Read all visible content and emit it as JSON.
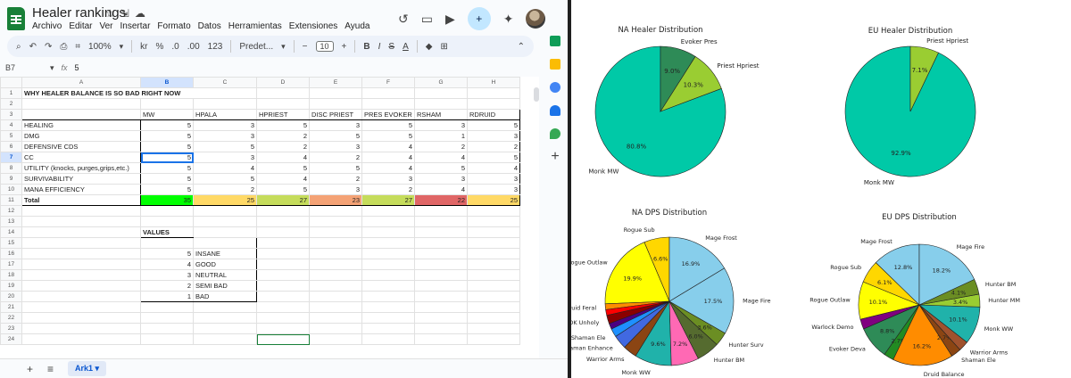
{
  "app": {
    "title": "Healer rankings",
    "menu": [
      "Archivo",
      "Editar",
      "Ver",
      "Insertar",
      "Formato",
      "Datos",
      "Herramientas",
      "Extensiones",
      "Ayuda"
    ]
  },
  "toolbar": {
    "zoom": "100%",
    "currency": "kr",
    "percent": "%",
    "dec_decrease": ".0",
    "dec_increase": ".00",
    "format_123": "123",
    "font": "Predet...",
    "font_size": "10",
    "minus": "−",
    "plus": "+",
    "bold": "B",
    "italic": "I",
    "strike": "S",
    "color_a": "A"
  },
  "formula_bar": {
    "name_box": "B7",
    "fx": "fx",
    "value": "5"
  },
  "grid": {
    "columns": [
      "A",
      "B",
      "C",
      "D",
      "E",
      "F",
      "G",
      "H"
    ],
    "title_row": "WHY HEALER BALANCE IS SO BAD RIGHT NOW",
    "headers": [
      "MW",
      "HPALA",
      "HPRIEST",
      "DISC PRIEST",
      "PRES EVOKER",
      "RSHAM",
      "RDRUID"
    ],
    "rows": [
      {
        "label": "HEALING",
        "values": [
          "5",
          "3",
          "5",
          "3",
          "5",
          "3",
          "5"
        ]
      },
      {
        "label": "DMG",
        "values": [
          "5",
          "3",
          "2",
          "5",
          "5",
          "1",
          "3"
        ]
      },
      {
        "label": "DEFENSIVE CDS",
        "values": [
          "5",
          "5",
          "2",
          "3",
          "4",
          "2",
          "2"
        ]
      },
      {
        "label": "CC",
        "values": [
          "5",
          "3",
          "4",
          "2",
          "4",
          "4",
          "5"
        ]
      },
      {
        "label": "UTILITY (knocks, purges,grips,etc.)",
        "values": [
          "5",
          "4",
          "5",
          "5",
          "4",
          "5",
          "4"
        ]
      },
      {
        "label": "SURVIVABILITY",
        "values": [
          "5",
          "5",
          "4",
          "2",
          "3",
          "3",
          "3"
        ]
      },
      {
        "label": "MANA EFFICIENCY",
        "values": [
          "5",
          "2",
          "5",
          "3",
          "2",
          "4",
          "3"
        ]
      }
    ],
    "total": {
      "label": "Total",
      "values": [
        "35",
        "25",
        "27",
        "23",
        "27",
        "22",
        "25"
      ],
      "colors": [
        "#00ff00",
        "#ffd966",
        "#c5dc5b",
        "#f4a275",
        "#c5dc5b",
        "#e06666",
        "#ffd966"
      ]
    },
    "values_title": "VALUES",
    "values_legend": [
      {
        "n": "5",
        "label": "INSANE"
      },
      {
        "n": "4",
        "label": "GOOD"
      },
      {
        "n": "3",
        "label": "NEUTRAL"
      },
      {
        "n": "2",
        "label": "SEMI BAD"
      },
      {
        "n": "1",
        "label": "BAD"
      }
    ]
  },
  "sheet_tab": "Ark1",
  "chart_data": [
    {
      "type": "pie",
      "title": "NA Healer Distribution",
      "slices": [
        {
          "label": "Monk MW",
          "value": 80.8,
          "pct": "80.8%",
          "color": "#00c9a7"
        },
        {
          "label": "Priest Hpriest",
          "value": 10.3,
          "pct": "10.3%",
          "color": "#9acd32"
        },
        {
          "label": "Evoker Pres",
          "value": 9.0,
          "pct": "9.0%",
          "color": "#2e8b57"
        }
      ]
    },
    {
      "type": "pie",
      "title": "EU Healer Distribution",
      "slices": [
        {
          "label": "Monk MW",
          "value": 92.9,
          "pct": "92.9%",
          "color": "#00c9a7"
        },
        {
          "label": "Priest Hpriest",
          "value": 7.1,
          "pct": "7.1%",
          "color": "#9acd32"
        }
      ]
    },
    {
      "type": "pie",
      "title": "NA DPS Distribution",
      "slices": [
        {
          "label": "Rogue Sub",
          "value": 6.6,
          "pct": "6.6%",
          "color": "#ffd700"
        },
        {
          "label": "Rogue Outlaw",
          "value": 19.9,
          "pct": "19.9%",
          "color": "#ffff00"
        },
        {
          "label": "Druid Feral",
          "value": 1.5,
          "pct": "",
          "color": "#ff8c00"
        },
        {
          "label": "",
          "value": 1.5,
          "pct": "",
          "color": "#ff0000"
        },
        {
          "label": "DK Unholy",
          "value": 2.2,
          "pct": "",
          "color": "#8b0000"
        },
        {
          "label": "",
          "value": 1.5,
          "pct": "",
          "color": "#4b0082"
        },
        {
          "label": "Shaman Ele",
          "value": 2.2,
          "pct": "",
          "color": "#1e90ff"
        },
        {
          "label": "Shaman Enhance",
          "value": 3.6,
          "pct": "",
          "color": "#4169e1"
        },
        {
          "label": "Warrior Arms",
          "value": 3.6,
          "pct": "",
          "color": "#8b4513"
        },
        {
          "label": "Monk WW",
          "value": 9.6,
          "pct": "9.6%",
          "color": "#20b2aa"
        },
        {
          "label": "",
          "value": 7.2,
          "pct": "7.2%",
          "color": "#ff69b4"
        },
        {
          "label": "Hunter BM",
          "value": 6.0,
          "pct": "6.0%",
          "color": "#556b2f"
        },
        {
          "label": "Hunter Surv",
          "value": 3.6,
          "pct": "3.6%",
          "color": "#6b8e23"
        },
        {
          "label": "Mage Fire",
          "value": 17.5,
          "pct": "17.5%",
          "color": "#87ceeb"
        },
        {
          "label": "Mage Frost",
          "value": 16.9,
          "pct": "16.9%",
          "color": "#87ceeb"
        }
      ]
    },
    {
      "type": "pie",
      "title": "EU DPS Distribution",
      "slices": [
        {
          "label": "Mage Frost",
          "value": 12.8,
          "pct": "12.8%",
          "color": "#87ceeb"
        },
        {
          "label": "Rogue Sub",
          "value": 6.1,
          "pct": "6.1%",
          "color": "#ffd700"
        },
        {
          "label": "Rogue Outlaw",
          "value": 10.1,
          "pct": "10.1%",
          "color": "#ffff00"
        },
        {
          "label": "Warlock Demo",
          "value": 2.7,
          "pct": "",
          "color": "#800080"
        },
        {
          "label": "Evoker Deva",
          "value": 8.8,
          "pct": "8.8%",
          "color": "#2e8b57"
        },
        {
          "label": "",
          "value": 2.7,
          "pct": "2.7%",
          "color": "#228b22"
        },
        {
          "label": "Druid Balance",
          "value": 16.2,
          "pct": "16.2%",
          "color": "#ff8c00"
        },
        {
          "label": "Shaman Ele",
          "value": 2.7,
          "pct": "2.7%",
          "color": "#8b4513"
        },
        {
          "label": "Warrior Arms",
          "value": 2.7,
          "pct": "",
          "color": "#a0522d"
        },
        {
          "label": "Monk WW",
          "value": 10.1,
          "pct": "10.1%",
          "color": "#20b2aa"
        },
        {
          "label": "Hunter MM",
          "value": 3.4,
          "pct": "3.4%",
          "color": "#9acd32"
        },
        {
          "label": "Hunter BM",
          "value": 4.1,
          "pct": "4.1%",
          "color": "#6b8e23"
        },
        {
          "label": "Mage Fire",
          "value": 18.2,
          "pct": "18.2%",
          "color": "#87ceeb"
        }
      ]
    }
  ]
}
